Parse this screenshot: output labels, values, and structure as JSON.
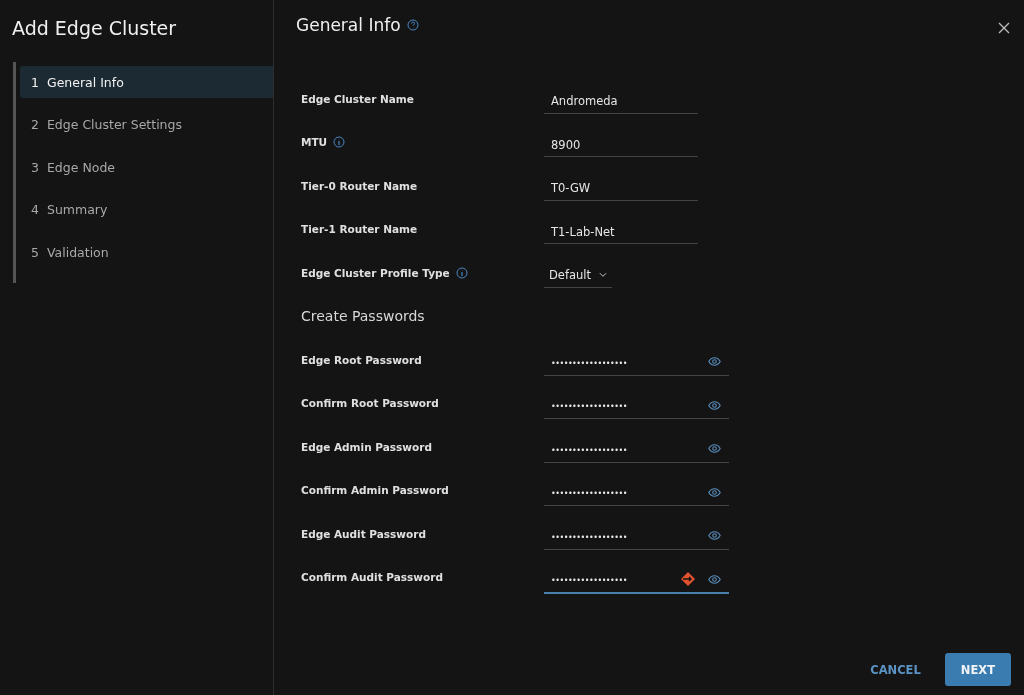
{
  "sidebar": {
    "title": "Add Edge Cluster",
    "steps": [
      {
        "number": "1",
        "label": "General Info",
        "selected": true
      },
      {
        "number": "2",
        "label": "Edge Cluster Settings",
        "selected": false
      },
      {
        "number": "3",
        "label": "Edge Node",
        "selected": false
      },
      {
        "number": "4",
        "label": "Summary",
        "selected": false
      },
      {
        "number": "5",
        "label": "Validation",
        "selected": false
      }
    ]
  },
  "main": {
    "title": "General Info",
    "fields": [
      {
        "kind": "text",
        "label": "Edge Cluster Name",
        "value": "Andromeda",
        "info": false
      },
      {
        "kind": "text",
        "label": "MTU",
        "value": "8900",
        "info": true
      },
      {
        "kind": "text",
        "label": "Tier-0 Router Name",
        "value": "T0-GW",
        "info": false
      },
      {
        "kind": "text",
        "label": "Tier-1 Router Name",
        "value": "T1-Lab-Net",
        "info": false
      },
      {
        "kind": "select",
        "label": "Edge Cluster Profile Type",
        "value": "Default",
        "info": true
      }
    ],
    "passwords": {
      "heading": "Create Passwords",
      "fields": [
        {
          "label": "Edge Root Password",
          "value": "••••••••••••••••••",
          "focused": false
        },
        {
          "label": "Confirm Root Password",
          "value": "••••••••••••••••••",
          "focused": false
        },
        {
          "label": "Edge Admin Password",
          "value": "••••••••••••••••••",
          "focused": false
        },
        {
          "label": "Confirm Admin Password",
          "value": "••••••••••••••••••",
          "focused": false
        },
        {
          "label": "Edge Audit Password",
          "value": "••••••••••••••••••",
          "focused": false
        },
        {
          "label": "Confirm Audit Password",
          "value": "••••••••••••••••••",
          "focused": true
        }
      ]
    }
  },
  "footer": {
    "buttons": [
      {
        "kind": "flat",
        "label": "CANCEL"
      },
      {
        "kind": "primary",
        "label": "NEXT"
      }
    ]
  }
}
